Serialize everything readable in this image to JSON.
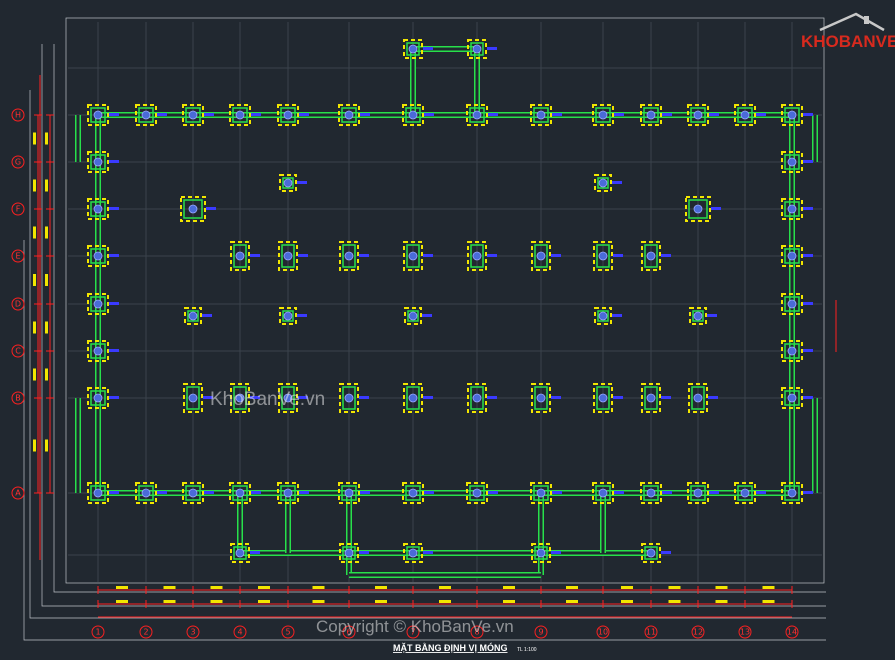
{
  "drawing": {
    "title": "MẶT BẰNG ĐỊNH VỊ MÓNG",
    "scale": "TL 1:100",
    "axes_numbers": [
      "1",
      "2",
      "3",
      "4",
      "5",
      "6",
      "7",
      "8",
      "9",
      "10",
      "11",
      "12",
      "13",
      "14"
    ],
    "axes_letters": [
      "H",
      "G",
      "F",
      "E",
      "D",
      "C",
      "B",
      "A"
    ]
  },
  "watermarks": {
    "center": "KhoBanVe.vn",
    "bottom": "Copyright © KhoBanVe.vn"
  },
  "logo": {
    "text": "KHOBANVE"
  },
  "colors": {
    "background": "#212830",
    "grid": "#3b424c",
    "axis": "#ff2020",
    "beam": "#27e04a",
    "footing": "#f2e600",
    "column": "#4a6bd8",
    "dim_text": "#00e5ff",
    "tag": "#3a3aff",
    "frame": "#c0c4c8"
  }
}
